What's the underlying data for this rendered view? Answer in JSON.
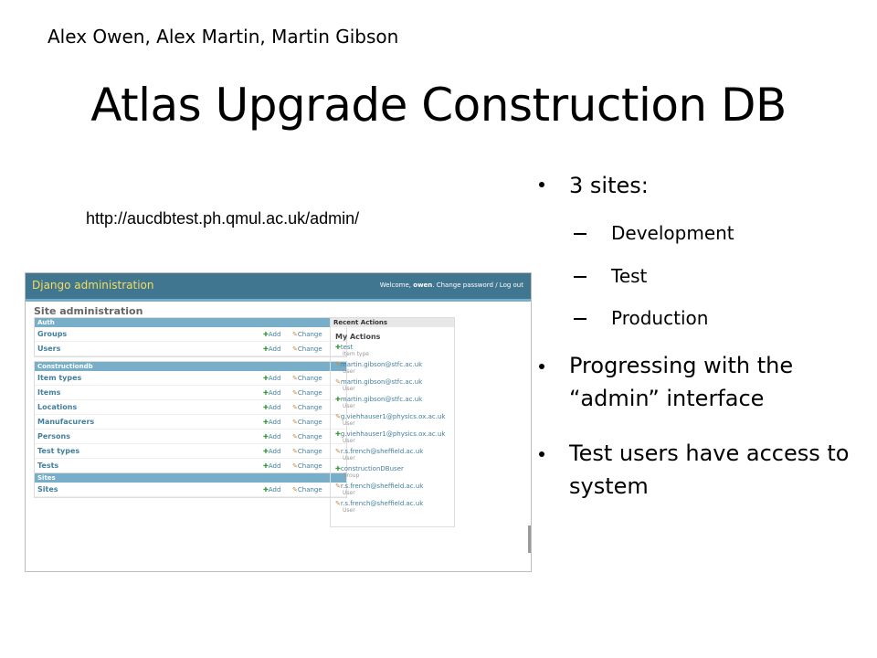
{
  "slide": {
    "authors": "Alex Owen, Alex Martin, Martin Gibson",
    "title": "Atlas Upgrade Construction DB",
    "url": "http://aucdbtest.ph.qmul.ac.uk/admin/"
  },
  "bullets": {
    "b1": "3 sites:",
    "sub": [
      "Development",
      "Test",
      "Production"
    ],
    "b2_l1": "Progressing with the",
    "b2_l2": "“admin” interface",
    "b3_l1": "Test users have access to",
    "b3_l2": "system"
  },
  "django": {
    "brand": "Django administration",
    "welcome_prefix": "Welcome, ",
    "user": "owen",
    "welcome_suffix": ". Change password / Log out",
    "site_title": "Site administration",
    "add_label": "Add",
    "change_label": "Change",
    "modules": [
      {
        "caption": "Auth",
        "rows": [
          "Groups",
          "Users"
        ]
      },
      {
        "caption": "Constructiondb",
        "rows": [
          "Item types",
          "Items",
          "Locations",
          "Manufacurers",
          "Persons",
          "Test types",
          "Tests"
        ]
      },
      {
        "caption": "Sites",
        "rows": [
          "Sites"
        ]
      }
    ],
    "recent": {
      "caption": "Recent Actions",
      "my_actions": "My Actions",
      "items": [
        {
          "icon": "plus",
          "obj": "test",
          "type": "Item type"
        },
        {
          "icon": "pencil",
          "obj": "martin.gibson@stfc.ac.uk",
          "type": "User"
        },
        {
          "icon": "pencil",
          "obj": "martin.gibson@stfc.ac.uk",
          "type": "User"
        },
        {
          "icon": "plus",
          "obj": "martin.gibson@stfc.ac.uk",
          "type": "User"
        },
        {
          "icon": "pencil",
          "obj": "g.viehhauser1@physics.ox.ac.uk",
          "type": "User"
        },
        {
          "icon": "plus",
          "obj": "g.viehhauser1@physics.ox.ac.uk",
          "type": "User"
        },
        {
          "icon": "pencil",
          "obj": "r.s.french@sheffield.ac.uk",
          "type": "User"
        },
        {
          "icon": "plus",
          "obj": "constructionDBuser",
          "type": "Group"
        },
        {
          "icon": "pencil",
          "obj": "r.s.french@sheffield.ac.uk",
          "type": "User"
        },
        {
          "icon": "pencil",
          "obj": "r.s.french@sheffield.ac.uk",
          "type": "User"
        }
      ]
    }
  },
  "colors": {
    "header": "#417690",
    "caption": "#79aec8",
    "link": "#447e9b",
    "brand": "#f5dd5d"
  }
}
